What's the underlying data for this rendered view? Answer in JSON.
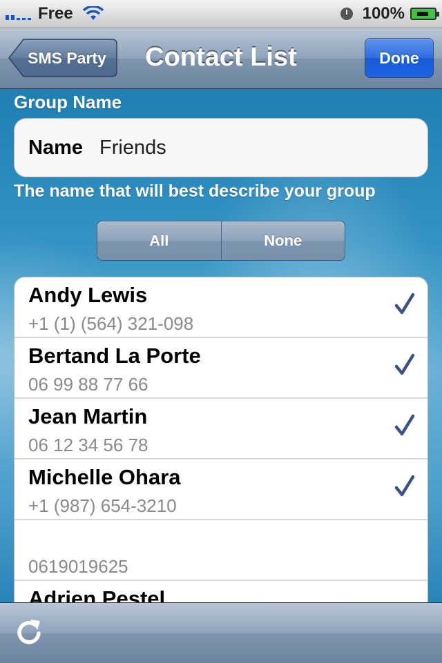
{
  "status_bar": {
    "carrier": "Free",
    "battery": "100%",
    "icons": [
      "signal-icon",
      "wifi-icon",
      "clock-icon",
      "battery-charging-icon"
    ]
  },
  "nav": {
    "back_label": "SMS Party",
    "title": "Contact List",
    "done_label": "Done"
  },
  "group": {
    "section_header": "Group Name",
    "name_label": "Name",
    "name_value": "Friends",
    "footer": "The name that will best describe your group"
  },
  "selector": {
    "all_label": "All",
    "none_label": "None"
  },
  "contacts": [
    {
      "name": "Andy Lewis",
      "phone": "+1 (1) (564) 321-098",
      "checked": true
    },
    {
      "name": "Bertand La Porte",
      "phone": "06 99 88 77 66",
      "checked": true
    },
    {
      "name": "Jean Martin",
      "phone": "06 12 34 56 78",
      "checked": true
    },
    {
      "name": "Michelle Ohara",
      "phone": "+1 (987) 654-3210",
      "checked": true
    },
    {
      "name": "",
      "phone": "0619019625",
      "checked": false
    },
    {
      "name": "Adrien Pestel",
      "phone": "",
      "checked": false
    }
  ],
  "colors": {
    "accent_blue": "#2f6ee0",
    "check_color": "#3a5186",
    "nav_bar": "#8ea3ba"
  },
  "toolbar": {
    "icons": [
      "refresh-icon"
    ]
  }
}
